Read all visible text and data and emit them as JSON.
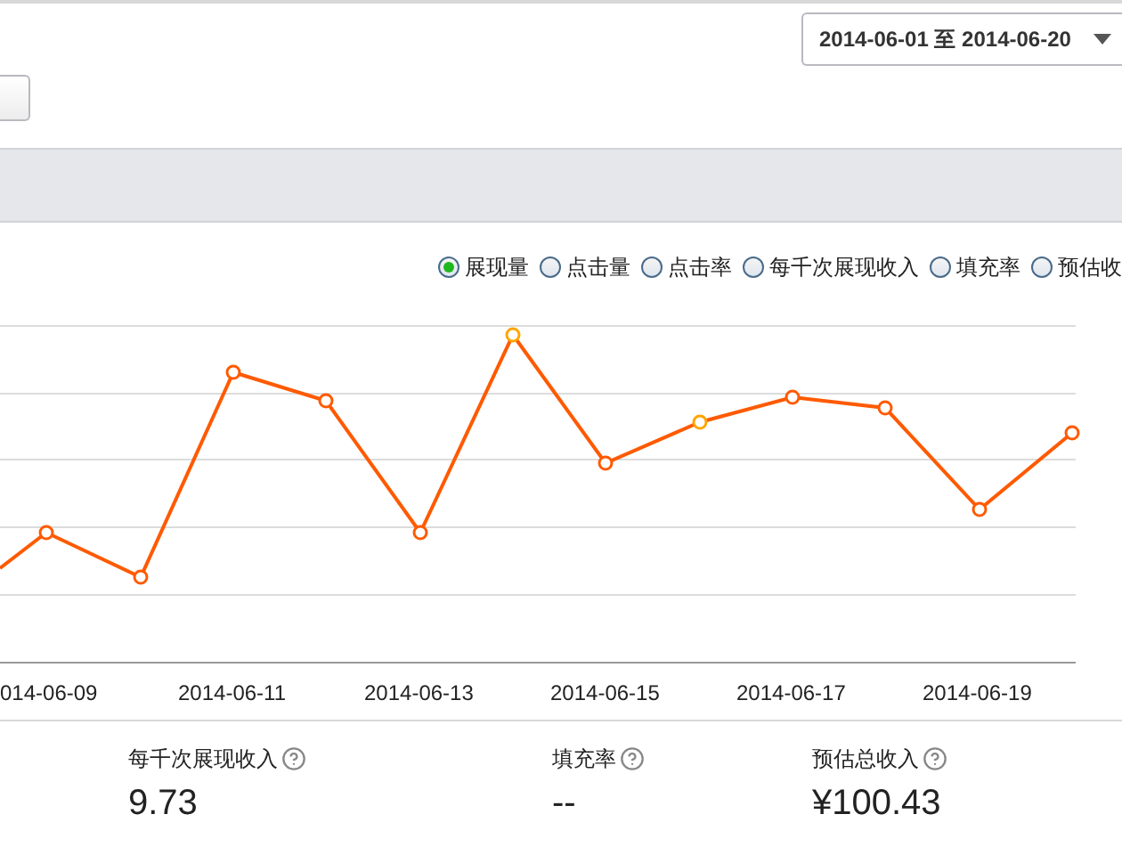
{
  "date_range": {
    "value": "2014-06-01 至 2014-06-20"
  },
  "legend": [
    {
      "label": "展现量",
      "selected": true
    },
    {
      "label": "点击量",
      "selected": false
    },
    {
      "label": "点击率",
      "selected": false
    },
    {
      "label": "每千次展现收入",
      "selected": false
    },
    {
      "label": "填充率",
      "selected": false
    },
    {
      "label": "预估收",
      "selected": false
    }
  ],
  "x_axis_labels": [
    "014-06-09",
    "2014-06-11",
    "2014-06-13",
    "2014-06-15",
    "2014-06-17",
    "2014-06-19"
  ],
  "stats": [
    {
      "label": "每千次展现收入",
      "value": "9.73"
    },
    {
      "label": "填充率",
      "value": "--"
    },
    {
      "label": "预估总收入",
      "value": "¥100.43"
    }
  ]
}
